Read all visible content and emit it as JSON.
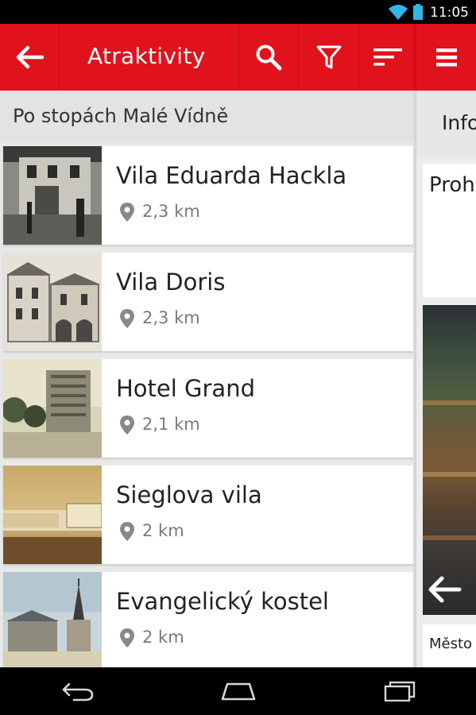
{
  "status_bar": {
    "time": "11:05"
  },
  "action_bar": {
    "title": "Atraktivity"
  },
  "section": {
    "title": "Po stopách Malé Vídně"
  },
  "items": [
    {
      "title": "Vila Eduarda Hackla",
      "distance": "2,3 km"
    },
    {
      "title": "Vila Doris",
      "distance": "2,3 km"
    },
    {
      "title": "Hotel Grand",
      "distance": "2,1 km"
    },
    {
      "title": "Sieglova vila",
      "distance": "2 km"
    },
    {
      "title": "Evangelický kostel",
      "distance": "2 km"
    }
  ],
  "right_panel": {
    "tab_label": "Info",
    "card_title": "Proh",
    "description_snippet": "Město"
  },
  "colors": {
    "accent": "#e0121b",
    "background": "#e8e8e8",
    "card": "#ffffff"
  },
  "icons": [
    "back-arrow-icon",
    "search-icon",
    "filter-icon",
    "sort-icon",
    "menu-icon",
    "location-pin-icon",
    "wifi-icon",
    "battery-icon",
    "nav-back-icon",
    "nav-home-icon",
    "nav-recents-icon"
  ]
}
